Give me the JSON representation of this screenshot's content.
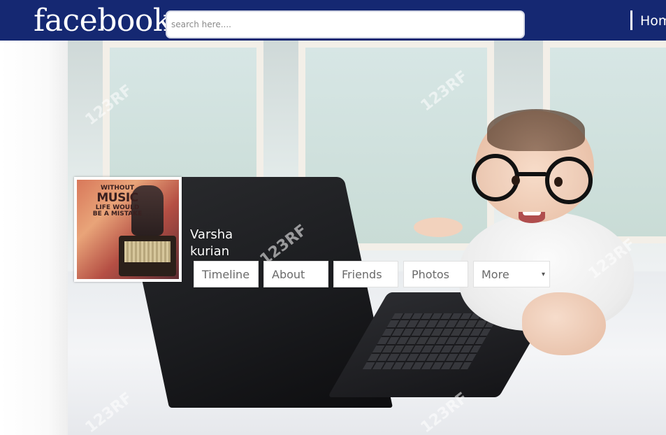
{
  "header": {
    "logo_text": "facebook",
    "search_placeholder": "search here....",
    "nav_home_label": "Hom",
    "bar_color": "#152872"
  },
  "profile": {
    "first_name": "Varsha",
    "last_name": "kurian",
    "picture_text": [
      "WITHOUT",
      "MUSIC",
      "LIFE WOULD",
      "BE A MISTAKE"
    ]
  },
  "tabs": [
    {
      "label": "Timeline"
    },
    {
      "label": "About"
    },
    {
      "label": "Friends"
    },
    {
      "label": "Photos"
    },
    {
      "label": "More",
      "caret": "▾"
    }
  ],
  "cover": {
    "watermark": "123RF"
  }
}
